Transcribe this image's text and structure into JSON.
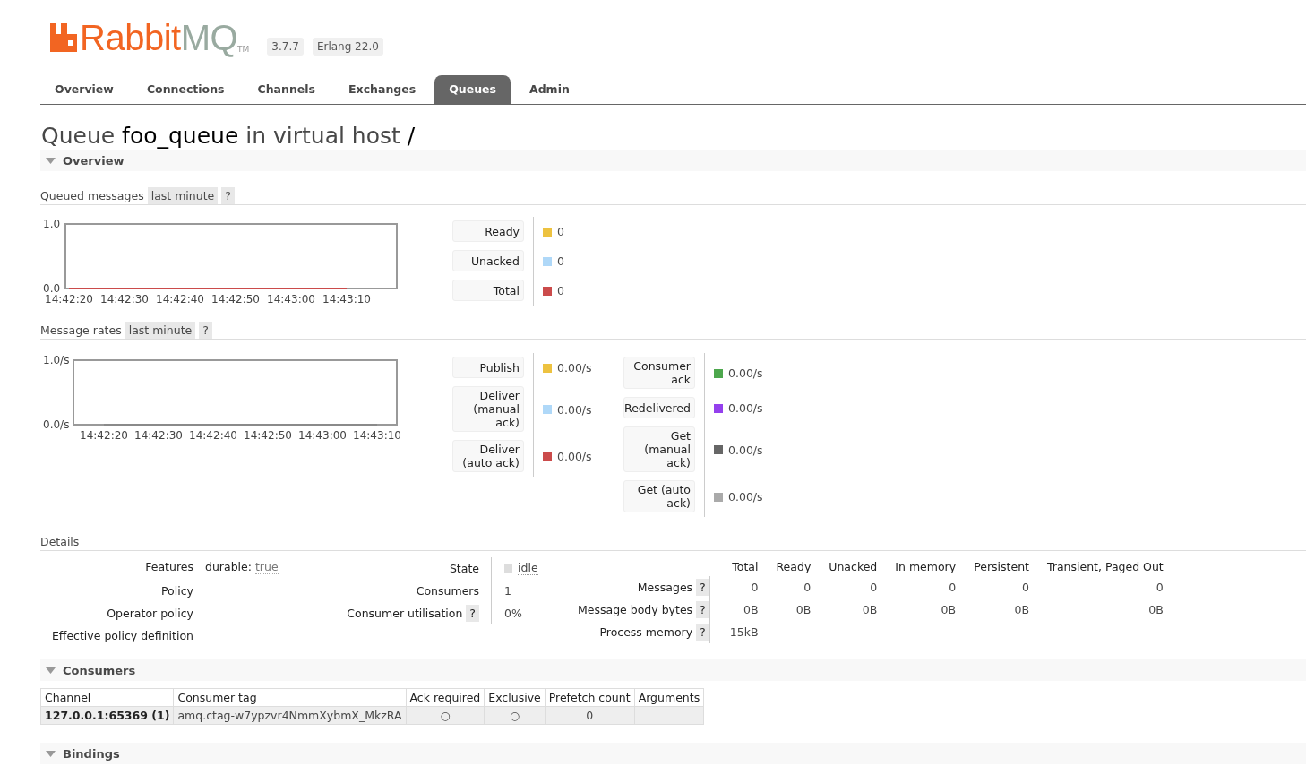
{
  "header": {
    "logo_primary": "Rabbit",
    "logo_secondary": "MQ",
    "logo_mark": "TM",
    "version": "3.7.7",
    "erlang": "Erlang 22.0"
  },
  "tabs": [
    {
      "label": "Overview",
      "selected": false
    },
    {
      "label": "Connections",
      "selected": false
    },
    {
      "label": "Channels",
      "selected": false
    },
    {
      "label": "Exchanges",
      "selected": false
    },
    {
      "label": "Queues",
      "selected": true
    },
    {
      "label": "Admin",
      "selected": false
    }
  ],
  "title": {
    "prefix": "Queue",
    "name": "foo_queue",
    "middle": "in virtual host",
    "vhost": "/"
  },
  "overview_section": {
    "title": "Overview",
    "expanded": true
  },
  "queued_messages": {
    "label": "Queued messages",
    "range": "last minute",
    "help": "?",
    "chart_data": {
      "type": "line",
      "categories": [
        "14:42:20",
        "14:42:30",
        "14:42:40",
        "14:42:50",
        "14:43:00",
        "14:43:10"
      ],
      "ylim": [
        0,
        1
      ],
      "yticks": [
        {
          "value": 0,
          "label": "0.0"
        },
        {
          "value": 1,
          "label": "1.0"
        }
      ],
      "series": [
        {
          "color": "#cb4b4b",
          "values": [
            0,
            0,
            0,
            0,
            0,
            0
          ]
        }
      ]
    },
    "legend": [
      {
        "label": "Ready",
        "color": "#edc240",
        "value": "0"
      },
      {
        "label": "Unacked",
        "color": "#afd8f8",
        "value": "0"
      },
      {
        "label": "Total",
        "color": "#cb4b4b",
        "value": "0"
      }
    ]
  },
  "message_rates": {
    "label": "Message rates",
    "range": "last minute",
    "help": "?",
    "chart_data": {
      "type": "line",
      "categories": [
        "14:42:20",
        "14:42:30",
        "14:42:40",
        "14:42:50",
        "14:43:00",
        "14:43:10"
      ],
      "ylim": [
        0,
        1
      ],
      "yticks": [
        {
          "value": 0,
          "label": "0.0/s"
        },
        {
          "value": 1,
          "label": "1.0/s"
        }
      ],
      "series": [
        {
          "color": "#8a8a8a",
          "values": [
            0,
            0,
            0,
            0,
            0,
            0
          ]
        }
      ]
    },
    "legend_left": [
      {
        "label": "Publish",
        "color": "#edc240",
        "value": "0.00/s"
      },
      {
        "label": "Deliver (manual ack)",
        "color": "#afd8f8",
        "value": "0.00/s"
      },
      {
        "label": "Deliver (auto ack)",
        "color": "#cb4b4b",
        "value": "0.00/s"
      }
    ],
    "legend_right": [
      {
        "label": "Consumer ack",
        "color": "#4da74d",
        "value": "0.00/s"
      },
      {
        "label": "Redelivered",
        "color": "#9440ed",
        "value": "0.00/s"
      },
      {
        "label": "Get (manual ack)",
        "color": "#666666",
        "value": "0.00/s"
      },
      {
        "label": "Get (auto ack)",
        "color": "#aaaaaa",
        "value": "0.00/s"
      }
    ]
  },
  "details": {
    "label": "Details",
    "properties": [
      {
        "label": "Features",
        "key": "durable:",
        "value": "true"
      },
      {
        "label": "Policy"
      },
      {
        "label": "Operator policy"
      },
      {
        "label": "Effective policy definition"
      }
    ],
    "state": {
      "label": "State",
      "value": "idle"
    },
    "consumers": {
      "label": "Consumers",
      "value": "1"
    },
    "utilisation": {
      "label": "Consumer utilisation",
      "help": "?",
      "value": "0%"
    },
    "message_columns": [
      "Total",
      "Ready",
      "Unacked",
      "In memory",
      "Persistent",
      "Transient, Paged Out"
    ],
    "message_rows": [
      {
        "label": "Messages",
        "help": "?",
        "values": [
          "0",
          "0",
          "0",
          "0",
          "0",
          "0"
        ]
      },
      {
        "label": "Message body bytes",
        "help": "?",
        "values": [
          "0B",
          "0B",
          "0B",
          "0B",
          "0B",
          "0B"
        ]
      },
      {
        "label": "Process memory",
        "help": "?",
        "values": [
          "15kB"
        ]
      }
    ]
  },
  "consumers_section": {
    "title": "Consumers",
    "expanded": true,
    "columns": [
      "Channel",
      "Consumer tag",
      "Ack required",
      "Exclusive",
      "Prefetch count",
      "Arguments"
    ],
    "rows": [
      {
        "channel": "127.0.0.1:65369 (1)",
        "tag": "amq.ctag-w7ypzvr4NmmXybmX_MkzRA",
        "ack_required": "○",
        "exclusive": "○",
        "prefetch": "0"
      }
    ]
  },
  "bindings_section": {
    "title": "Bindings",
    "expanded": true
  }
}
